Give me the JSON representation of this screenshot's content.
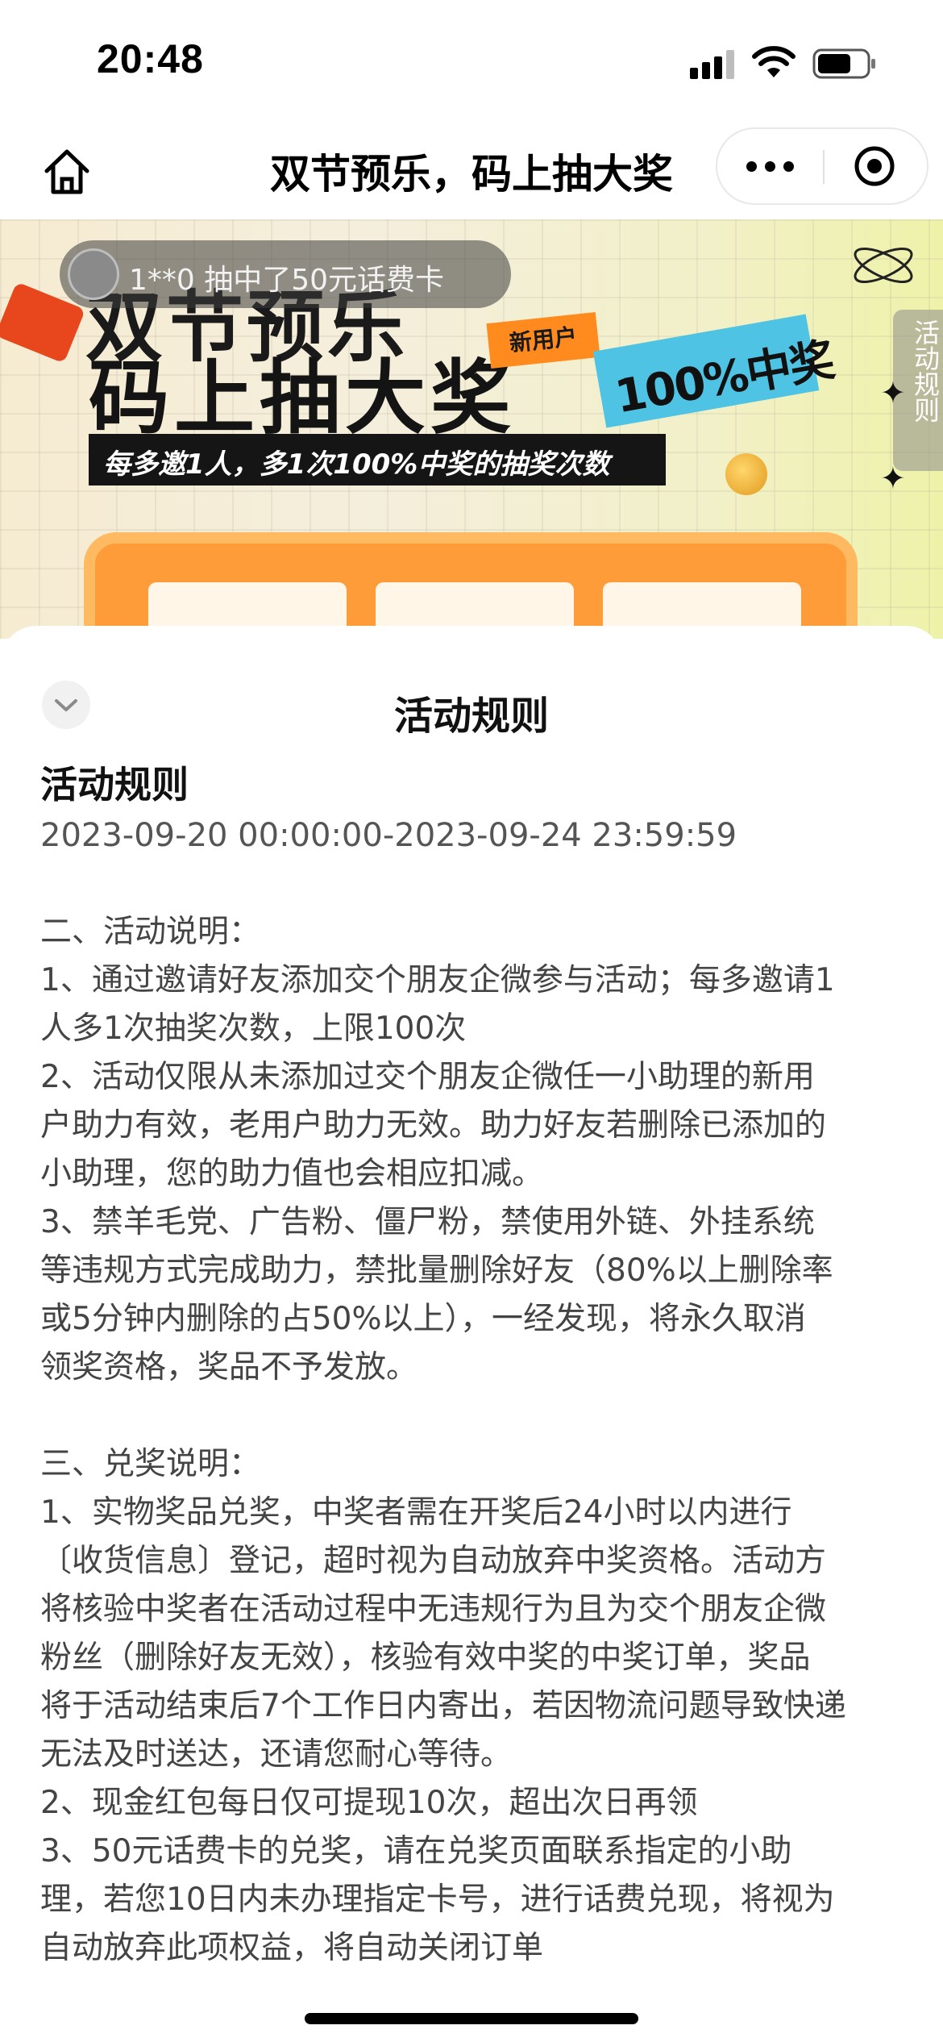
{
  "status_bar": {
    "time": "20:48",
    "icons": [
      "signal-icon",
      "wifi-icon",
      "battery-icon"
    ]
  },
  "nav": {
    "title": "双节预乐，码上抽大奖",
    "icons": [
      "home-icon",
      "more-icon",
      "close-icon"
    ]
  },
  "banner": {
    "ticker": "1**0 抽中了50元话费卡",
    "title_line1": "双节预乐",
    "title_line2": "码上抽大奖",
    "subtitle": "每多邀1人，多1次100%中奖的抽奖次数",
    "new_user_tag": "新用户",
    "percent_tag": "100%中奖",
    "rules_tab": "活动规则"
  },
  "sheet": {
    "title": "活动规则",
    "heading": "活动规则",
    "period": "2023-09-20 00:00:00-2023-09-24 23:59:59",
    "lines": [
      "",
      "二、活动说明：",
      "1、通过邀请好友添加交个朋友企微参与活动；每多邀请1",
      "人多1次抽奖次数，上限100次",
      "2、活动仅限从未添加过交个朋友企微任一小助理的新用",
      "户助力有效，老用户助力无效。助力好友若删除已添加的",
      "小助理，您的助力值也会相应扣减。",
      "3、禁羊毛党、广告粉、僵尸粉，禁使用外链、外挂系统",
      "等违规方式完成助力，禁批量删除好友（80%以上删除率",
      "或5分钟内删除的占50%以上），一经发现，将永久取消",
      "领奖资格，奖品不予发放。",
      "",
      "三、兑奖说明：",
      "1、实物奖品兑奖，中奖者需在开奖后24小时以内进行",
      "〔收货信息〕登记，超时视为自动放弃中奖资格。活动方",
      "将核验中奖者在活动过程中无违规行为且为交个朋友企微",
      "粉丝（删除好友无效），核验有效中奖的中奖订单，奖品",
      "将于活动结束后7个工作日内寄出，若因物流问题导致快递",
      "无法及时送达，还请您耐心等待。",
      "2、现金红包每日仅可提现10次，超出次日再领",
      "3、50元话费卡的兑奖，请在兑奖页面联系指定的小助",
      "理，若您10日内未办理指定卡号，进行话费兑现，将视为",
      "自动放弃此项权益，将自动关闭订单"
    ]
  }
}
